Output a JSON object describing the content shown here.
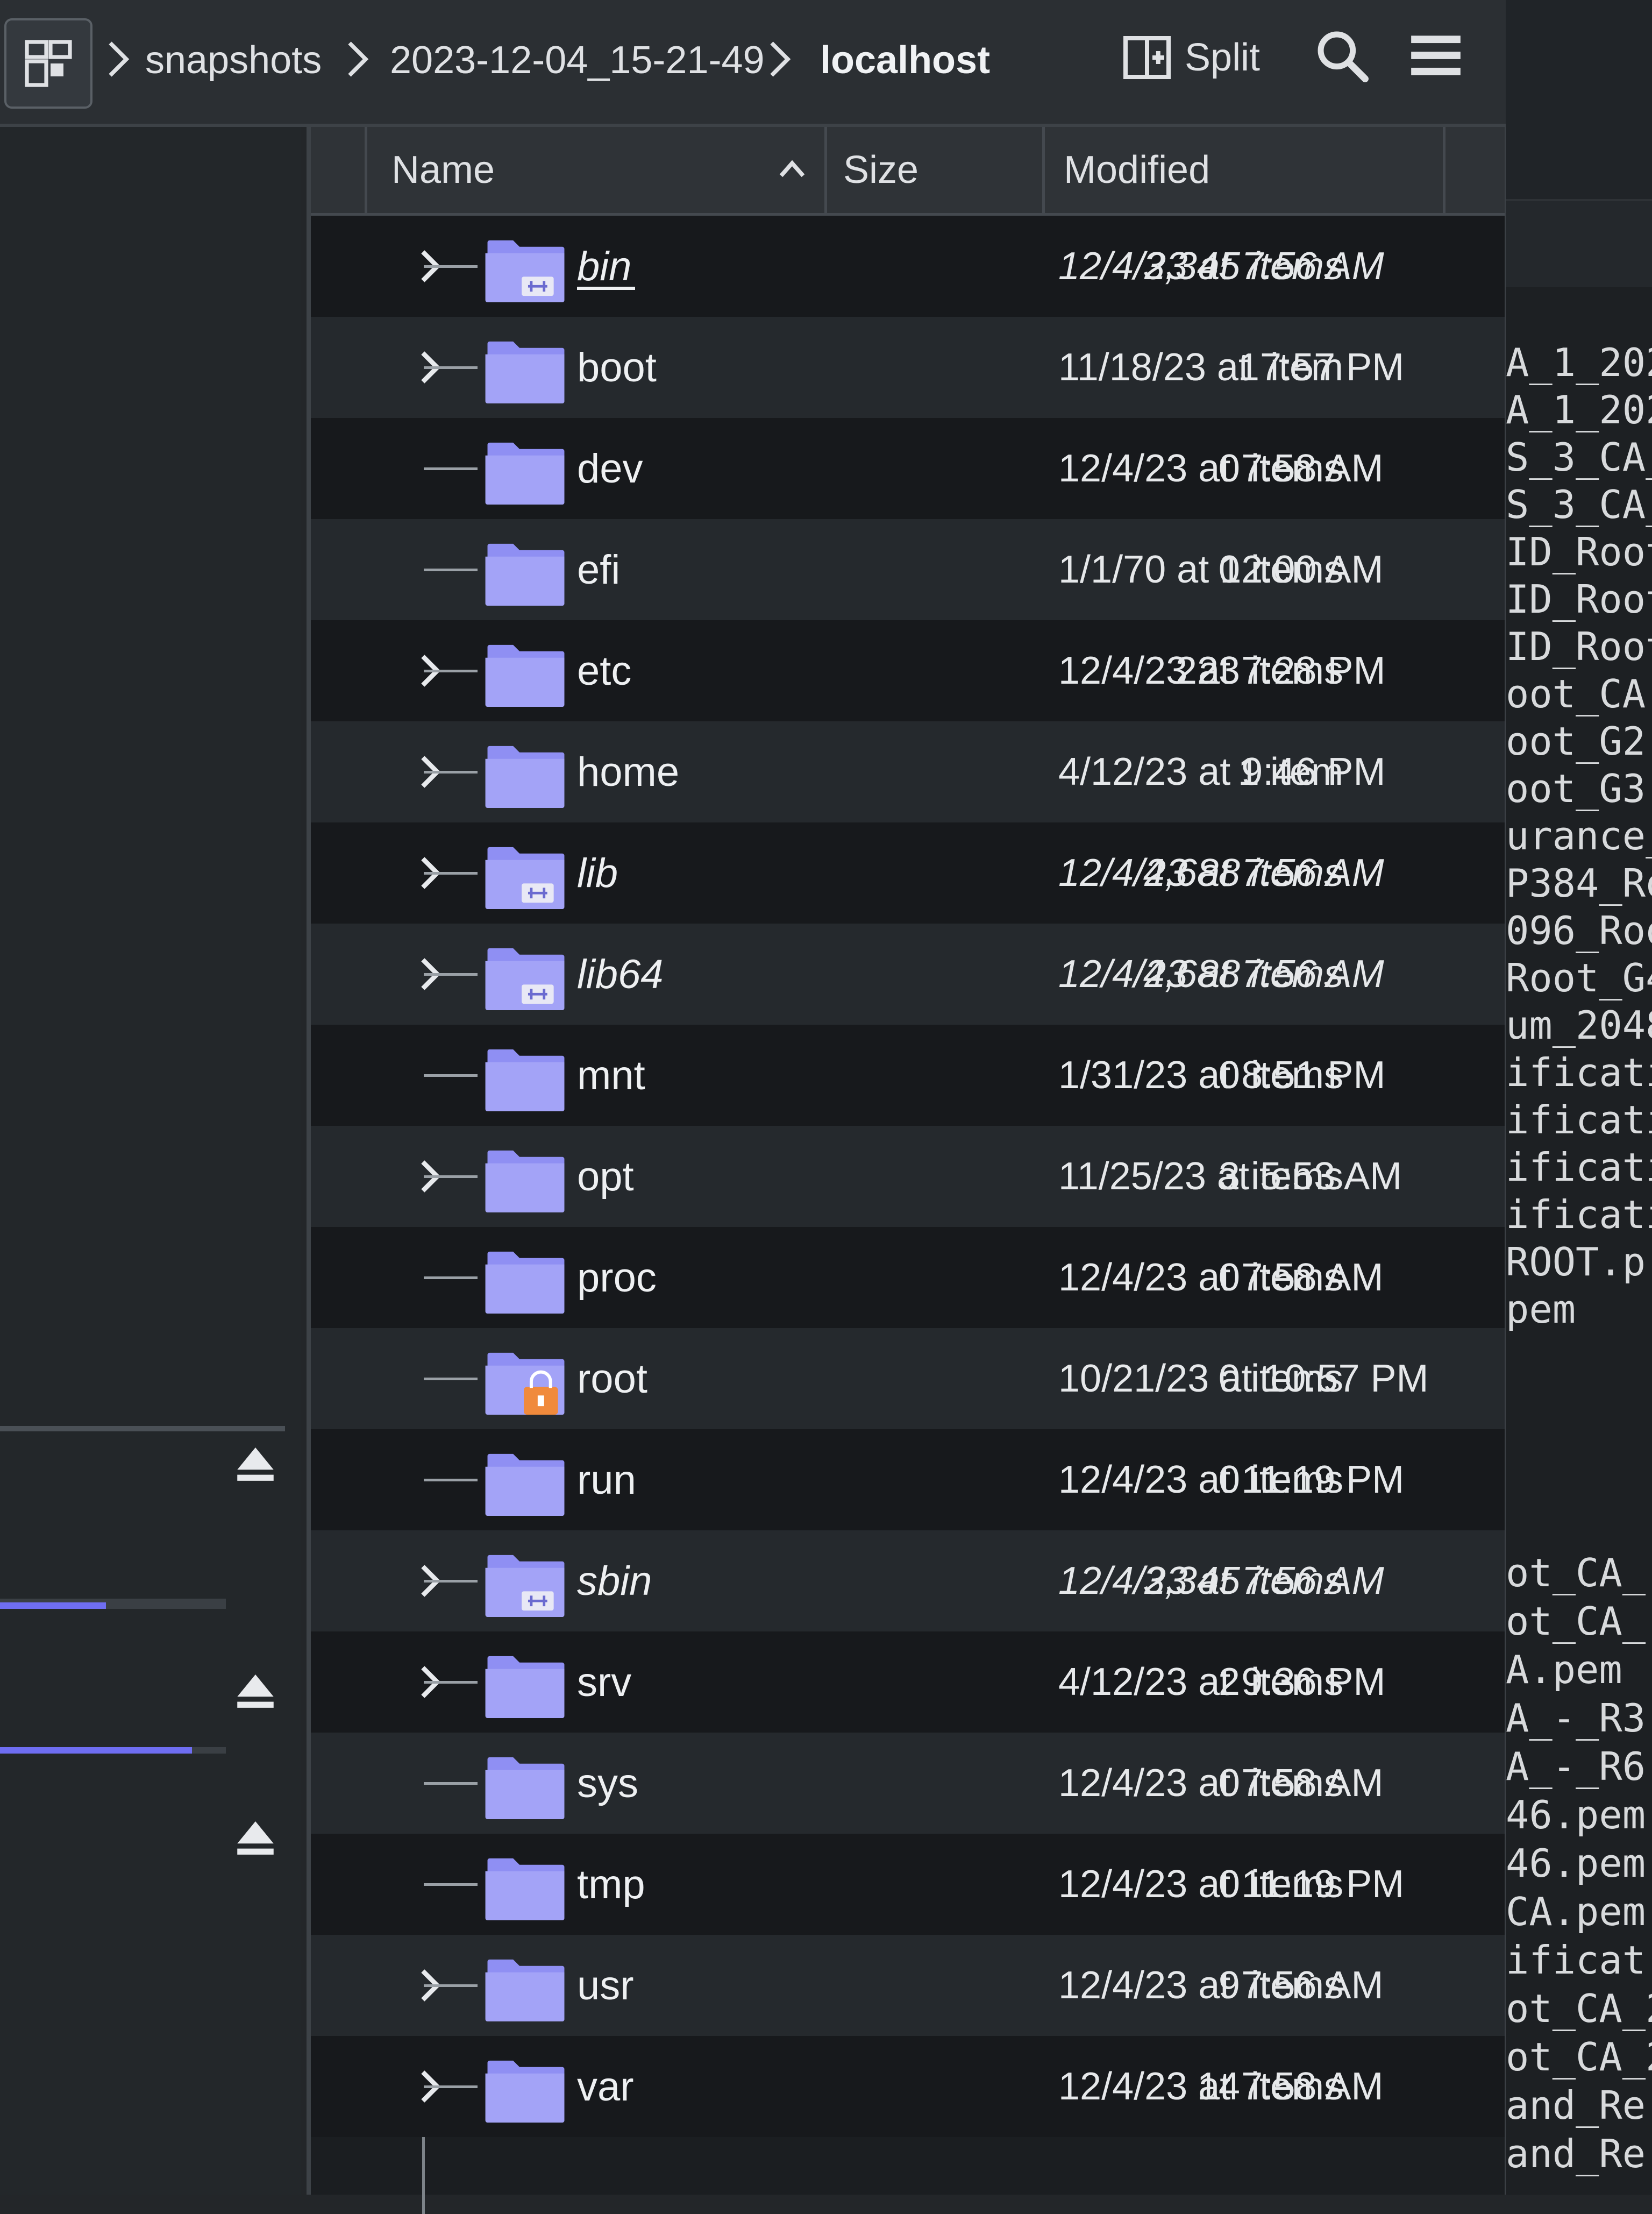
{
  "breadcrumb": {
    "items": [
      "snapshots",
      "2023-12-04_15-21-49",
      "localhost"
    ]
  },
  "toolbar": {
    "split_label": "Split"
  },
  "columns": {
    "name": "Name",
    "size": "Size",
    "modified": "Modified"
  },
  "files": [
    {
      "name": "bin",
      "size": "3,345 items",
      "modified": "12/4/23 at 7:56 AM",
      "link": true,
      "expandable": true
    },
    {
      "name": "boot",
      "size": "1 item",
      "modified": "11/18/23 at 7:57 PM",
      "link": false,
      "expandable": true
    },
    {
      "name": "dev",
      "size": "0 items",
      "modified": "12/4/23 at 7:58 AM",
      "link": false,
      "expandable": false
    },
    {
      "name": "efi",
      "size": "0 items",
      "modified": "1/1/70 at 12:00 AM",
      "link": false,
      "expandable": false
    },
    {
      "name": "etc",
      "size": "223 items",
      "modified": "12/4/23 at 7:28 PM",
      "link": false,
      "expandable": true
    },
    {
      "name": "home",
      "size": "1 item",
      "modified": "4/12/23 at 9:46 PM",
      "link": false,
      "expandable": true
    },
    {
      "name": "lib",
      "size": "4,688 items",
      "modified": "12/4/23 at 7:56 AM",
      "link": true,
      "expandable": true
    },
    {
      "name": "lib64",
      "size": "4,688 items",
      "modified": "12/4/23 at 7:56 AM",
      "link": true,
      "expandable": true
    },
    {
      "name": "mnt",
      "size": "0 items",
      "modified": "1/31/23 at 8:51 PM",
      "link": false,
      "expandable": false
    },
    {
      "name": "opt",
      "size": "3 items",
      "modified": "11/25/23 at 5:53 AM",
      "link": false,
      "expandable": true
    },
    {
      "name": "proc",
      "size": "0 items",
      "modified": "12/4/23 at 7:58 AM",
      "link": false,
      "expandable": false
    },
    {
      "name": "root",
      "size": "0 items",
      "modified": "10/21/23 at 10:57 PM",
      "link": false,
      "expandable": false,
      "locked": true
    },
    {
      "name": "run",
      "size": "0 items",
      "modified": "12/4/23 at 11:19 PM",
      "link": false,
      "expandable": false
    },
    {
      "name": "sbin",
      "size": "3,345 items",
      "modified": "12/4/23 at 7:56 AM",
      "link": true,
      "expandable": true
    },
    {
      "name": "srv",
      "size": "2 items",
      "modified": "4/12/23 at 9:36 PM",
      "link": false,
      "expandable": true
    },
    {
      "name": "sys",
      "size": "0 items",
      "modified": "12/4/23 at 7:58 AM",
      "link": false,
      "expandable": false
    },
    {
      "name": "tmp",
      "size": "0 items",
      "modified": "12/4/23 at 11:19 PM",
      "link": false,
      "expandable": false
    },
    {
      "name": "usr",
      "size": "9 items",
      "modified": "12/4/23 at 7:56 AM",
      "link": false,
      "expandable": true
    },
    {
      "name": "var",
      "size": "14 items",
      "modified": "12/4/23 at 7:58 AM",
      "link": false,
      "expandable": true
    }
  ],
  "places": {
    "devices": [
      {
        "usage_fraction": 0.0
      },
      {
        "usage_fraction": 0.47
      },
      {
        "usage_fraction": 0.85
      }
    ]
  },
  "terminal": {
    "lines_top": [
      "A_1_202",
      "A_1_202",
      "S_3_CA_",
      "S_3_CA_",
      "ID_Root",
      "ID_Root",
      "ID_Root",
      "oot_CA.",
      "oot_G2.",
      "oot_G3.",
      "urance_",
      "P384_Ro",
      "096_Roo",
      "Root_G4",
      "um_2048",
      "ificati",
      "ificati",
      "ificati",
      "ificati",
      "ROOT.p",
      "pem"
    ],
    "lines_bottom": [
      "ot_CA_-",
      "ot_CA_-",
      "A.pem",
      "A_-_R3.",
      "A_-_R6.",
      "46.pem",
      "46.pem",
      "CA.pem",
      "ificat",
      "ot_CA_2",
      "ot_CA_2",
      "and_Re",
      "and_Re"
    ]
  },
  "colors": {
    "folder": "#8f8ff3",
    "accent": "#6f6ef2",
    "lock": "#f08a3c"
  }
}
